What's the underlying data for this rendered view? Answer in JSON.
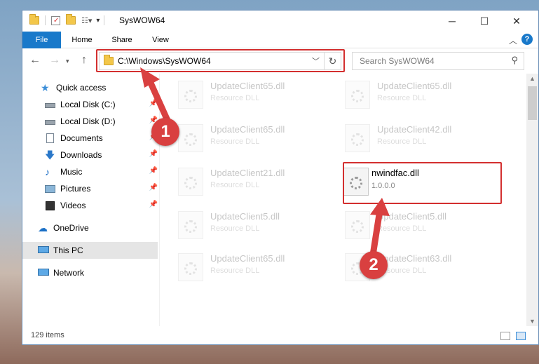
{
  "window": {
    "title": "SysWOW64",
    "minimize": "─",
    "maximize": "☐",
    "close": "✕"
  },
  "ribbon": {
    "tabs": [
      "File",
      "Home",
      "Share",
      "View"
    ],
    "help": "?"
  },
  "navigation": {
    "address": "C:\\Windows\\SysWOW64",
    "search_placeholder": "Search SysWOW64"
  },
  "sidebar": {
    "items": [
      {
        "label": "Quick access",
        "icon": "star-icon"
      },
      {
        "label": "Local Disk (C:)",
        "icon": "drive-icon",
        "pinned": true
      },
      {
        "label": "Local Disk (D:)",
        "icon": "drive-icon",
        "pinned": true
      },
      {
        "label": "Documents",
        "icon": "documents-icon",
        "pinned": true
      },
      {
        "label": "Downloads",
        "icon": "download-icon",
        "pinned": true
      },
      {
        "label": "Music",
        "icon": "music-icon",
        "pinned": true
      },
      {
        "label": "Pictures",
        "icon": "pictures-icon",
        "pinned": true
      },
      {
        "label": "Videos",
        "icon": "videos-icon",
        "pinned": true
      },
      {
        "label": "OneDrive",
        "icon": "cloud-icon"
      },
      {
        "label": "This PC",
        "icon": "computer-icon",
        "selected": true
      },
      {
        "label": "Network",
        "icon": "network-icon"
      }
    ]
  },
  "files": [
    {
      "name": "UpdateClient65.dll",
      "sub": "Resource DLL"
    },
    {
      "name": "UpdateClient65.dll",
      "sub": "Resource DLL"
    },
    {
      "name": "UpdateClient65.dll",
      "sub": "Resource DLL"
    },
    {
      "name": "UpdateClient42.dll",
      "sub": "Resource DLL"
    },
    {
      "name": "UpdateClient21.dll",
      "sub": "Resource DLL"
    },
    {
      "name": "nwindfac.dll",
      "sub": "1.0.0.0"
    },
    {
      "name": "UpdateClient5.dll",
      "sub": "Resource DLL"
    },
    {
      "name": "UpdateClient5.dll",
      "sub": "Resource DLL"
    },
    {
      "name": "UpdateClient65.dll",
      "sub": "Resource DLL"
    },
    {
      "name": "UpdateClient63.dll",
      "sub": "Resource DLL"
    }
  ],
  "status": {
    "item_count": "129 items"
  },
  "annotations": {
    "step1": "1",
    "step2": "2",
    "color": "#d32f2f"
  }
}
